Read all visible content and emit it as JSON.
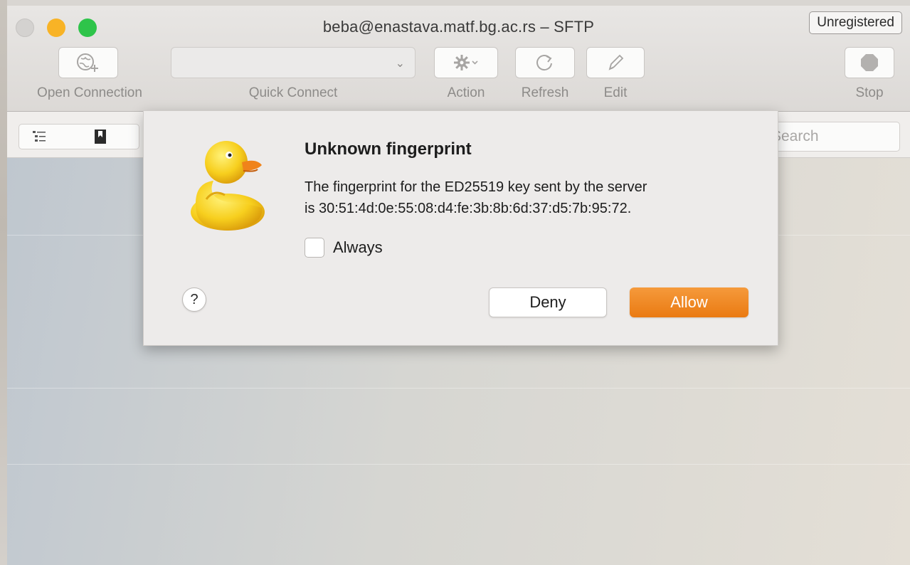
{
  "window": {
    "title": "beba@enastava.matf.bg.ac.rs – SFTP",
    "badge": "Unregistered"
  },
  "toolbar": {
    "open_connection": "Open Connection",
    "quick_connect": "Quick Connect",
    "action": "Action",
    "refresh": "Refresh",
    "edit": "Edit",
    "stop": "Stop"
  },
  "search": {
    "placeholder": "Search"
  },
  "dialog": {
    "title": "Unknown fingerprint",
    "message_line1": "The fingerprint for the ED25519 key sent by the server",
    "message_line2": "is 30:51:4d:0e:55:08:d4:fe:3b:8b:6d:37:d5:7b:95:72.",
    "checkbox_label": "Always",
    "checkbox_checked": false,
    "help": "?",
    "deny": "Deny",
    "allow": "Allow"
  },
  "colors": {
    "accent": "#ee8420",
    "traffic_close": "#d4d2d0",
    "traffic_min": "#f8b326",
    "traffic_max": "#2ec44a"
  },
  "icons": [
    "globe-plus-icon",
    "chevron-down-icon",
    "gear-icon",
    "refresh-icon",
    "pencil-icon",
    "stop-icon",
    "outline-view-icon",
    "bookmark-icon",
    "duck-icon"
  ]
}
